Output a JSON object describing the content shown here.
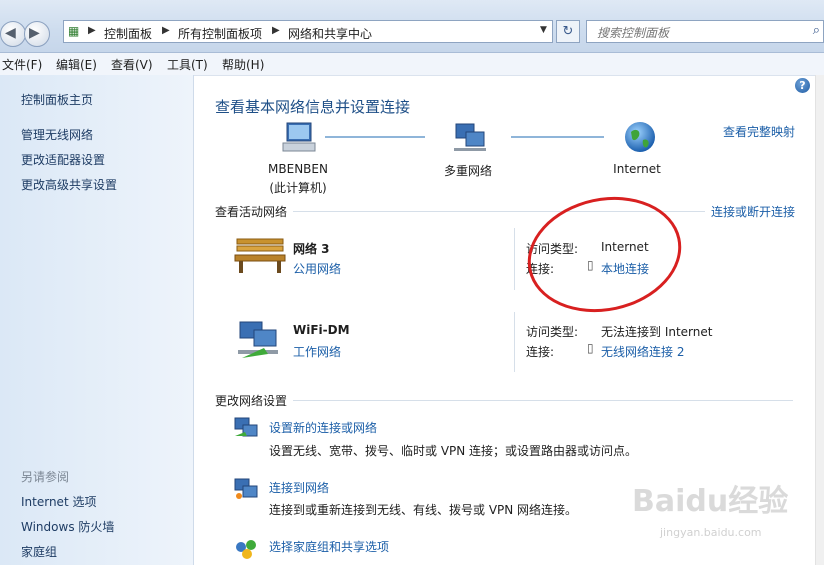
{
  "address": {
    "crumbs": [
      "控制面板",
      "所有控制面板项",
      "网络和共享中心"
    ]
  },
  "search": {
    "placeholder": "搜索控制面板"
  },
  "menu": [
    "文件(F)",
    "编辑(E)",
    "查看(V)",
    "工具(T)",
    "帮助(H)"
  ],
  "sidebar": {
    "home": "控制面板主页",
    "items": [
      "管理无线网络",
      "更改适配器设置",
      "更改高级共享设置"
    ],
    "see_also_title": "另请参阅",
    "see_also": [
      "Internet 选项",
      "Windows 防火墙",
      "家庭组"
    ]
  },
  "main": {
    "title": "查看基本网络信息并设置连接",
    "full_map_link": "查看完整映射",
    "map": {
      "computer_name": "MBENBEN",
      "computer_sub": "(此计算机)",
      "network": "多重网络",
      "internet": "Internet"
    },
    "active_section": "查看活动网络",
    "connect_link": "连接或断开连接",
    "networks": [
      {
        "name": "网络  3",
        "type": "公用网络",
        "access_label": "访问类型:",
        "access_value": "Internet",
        "conn_label": "连接:",
        "conn_value": "本地连接"
      },
      {
        "name": "WiFi-DM",
        "type": "工作网络",
        "access_label": "访问类型:",
        "access_value": "无法连接到 Internet",
        "conn_label": "连接:",
        "conn_value": "无线网络连接 2"
      }
    ],
    "change_section": "更改网络设置",
    "tasks": [
      {
        "title": "设置新的连接或网络",
        "desc": "设置无线、宽带、拨号、临时或 VPN 连接；或设置路由器或访问点。"
      },
      {
        "title": "连接到网络",
        "desc": "连接到或重新连接到无线、有线、拨号或 VPN 网络连接。"
      },
      {
        "title": "选择家庭组和共享选项",
        "desc": ""
      }
    ]
  },
  "watermark": {
    "brand": "Baidu经验",
    "url": "jingyan.baidu.com"
  },
  "colors": {
    "link": "#1c5fa8",
    "annotation": "#d82020",
    "sidebar": "#dbe8f6"
  }
}
